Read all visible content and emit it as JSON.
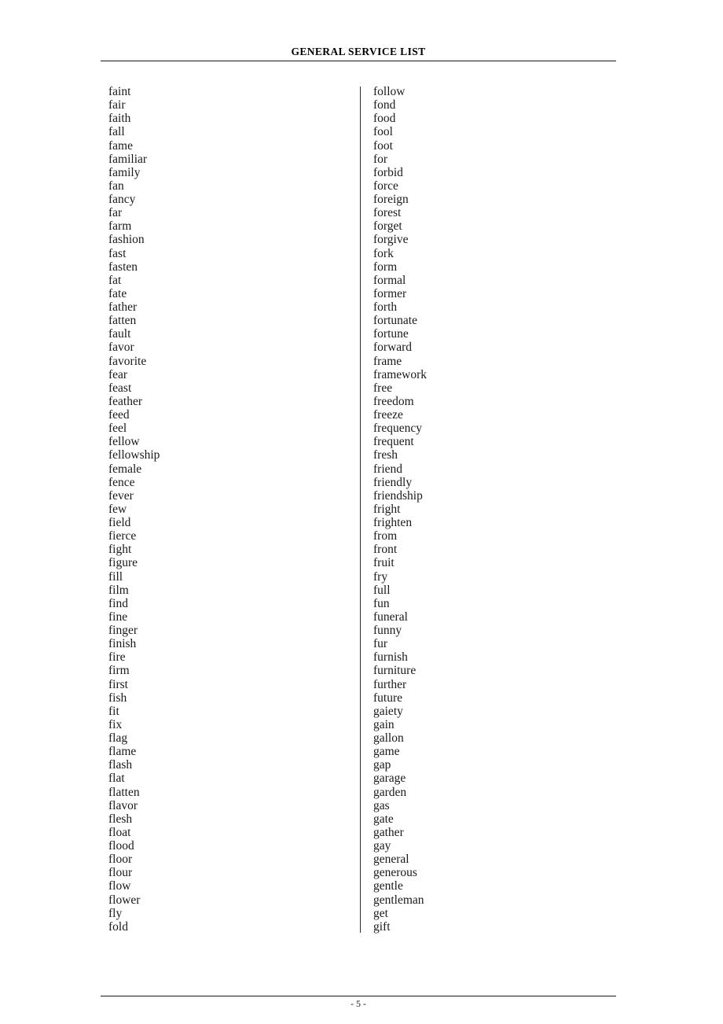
{
  "document": {
    "running_head": "GENERAL SERVICE LIST",
    "page_number": "- 5 -"
  },
  "columns": {
    "left": [
      "faint",
      "fair",
      "faith",
      "fall",
      "fame",
      "familiar",
      "family",
      "fan",
      "fancy",
      "far",
      "farm",
      "fashion",
      "fast",
      "fasten",
      "fat",
      "fate",
      "father",
      "fatten",
      "fault",
      "favor",
      "favorite",
      "fear",
      "feast",
      "feather",
      "feed",
      "feel",
      "fellow",
      "fellowship",
      "female",
      "fence",
      "fever",
      "few",
      "field",
      "fierce",
      "fight",
      "figure",
      "fill",
      "film",
      "find",
      "fine",
      "finger",
      "finish",
      "fire",
      "firm",
      "first",
      "fish",
      "fit",
      "fix",
      "flag",
      "flame",
      "flash",
      "flat",
      "flatten",
      "flavor",
      "flesh",
      "float",
      "flood",
      "floor",
      "flour",
      "flow",
      "flower",
      "fly",
      "fold"
    ],
    "right": [
      "follow",
      "fond",
      "food",
      "fool",
      "foot",
      "for",
      "forbid",
      "force",
      "foreign",
      "forest",
      "forget",
      "forgive",
      "fork",
      "form",
      "formal",
      "former",
      "forth",
      "fortunate",
      "fortune",
      "forward",
      "frame",
      "framework",
      "free",
      "freedom",
      "freeze",
      "frequency",
      "frequent",
      "fresh",
      "friend",
      "friendly",
      "friendship",
      "fright",
      "frighten",
      "from",
      "front",
      "fruit",
      "fry",
      "full",
      "fun",
      "funeral",
      "funny",
      "fur",
      "furnish",
      "furniture",
      "further",
      "future",
      "gaiety",
      "gain",
      "gallon",
      "game",
      "gap",
      "garage",
      "garden",
      "gas",
      "gate",
      "gather",
      "gay",
      "general",
      "generous",
      "gentle",
      "gentleman",
      "get",
      "gift"
    ]
  }
}
